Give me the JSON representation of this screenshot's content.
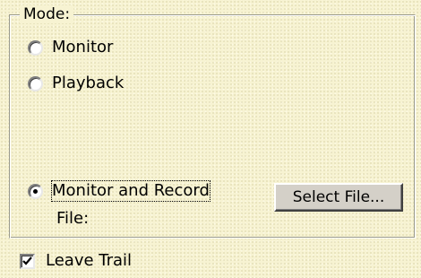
{
  "mode_group": {
    "legend": "Mode:",
    "options": [
      {
        "label": "Monitor",
        "checked": false
      },
      {
        "label": "Playback",
        "checked": false
      },
      {
        "label": "Monitor and Record",
        "checked": true
      }
    ],
    "file_label": "File:",
    "select_file_button": "Select File..."
  },
  "leave_trail": {
    "label": "Leave Trail",
    "checked": true
  },
  "colors": {
    "background": "#f7f3d2",
    "button_face": "#d4d0c8"
  }
}
